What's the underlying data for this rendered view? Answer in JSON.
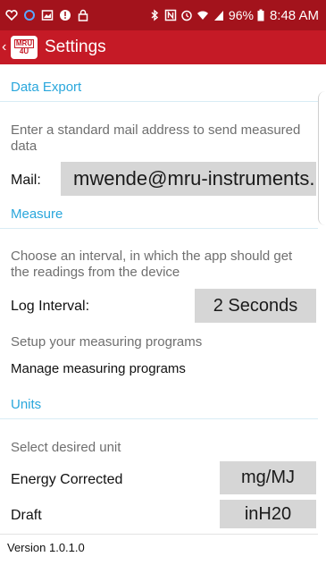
{
  "status_bar": {
    "battery": "96%",
    "time": "8:48 AM"
  },
  "app_bar": {
    "back_glyph": "‹",
    "logo_line1": "MRU",
    "logo_line2": "4U",
    "title": "Settings"
  },
  "data_export": {
    "header": "Data Export",
    "hint": "Enter a standard mail address to send measured data",
    "mail_label": "Mail:",
    "mail_value": "mwende@mru-instruments."
  },
  "measure": {
    "header": "Measure",
    "hint": "Choose an interval, in which the app should get the readings from the device",
    "log_interval_label": "Log Interval:",
    "log_interval_value": "2 Seconds",
    "programs_hint": "Setup your measuring programs",
    "manage_programs_label": "Manage measuring programs"
  },
  "units": {
    "header": "Units",
    "hint": "Select desired unit",
    "energy_label": "Energy Corrected",
    "energy_value": "mg/MJ",
    "draft_label": "Draft",
    "draft_value": "inH20"
  },
  "version": "Version 1.0.1.0",
  "colors": {
    "status_bar": "#a3131c",
    "app_bar": "#c51a26",
    "section_header": "#2aa7dc",
    "value_box": "#d6d6d6"
  }
}
